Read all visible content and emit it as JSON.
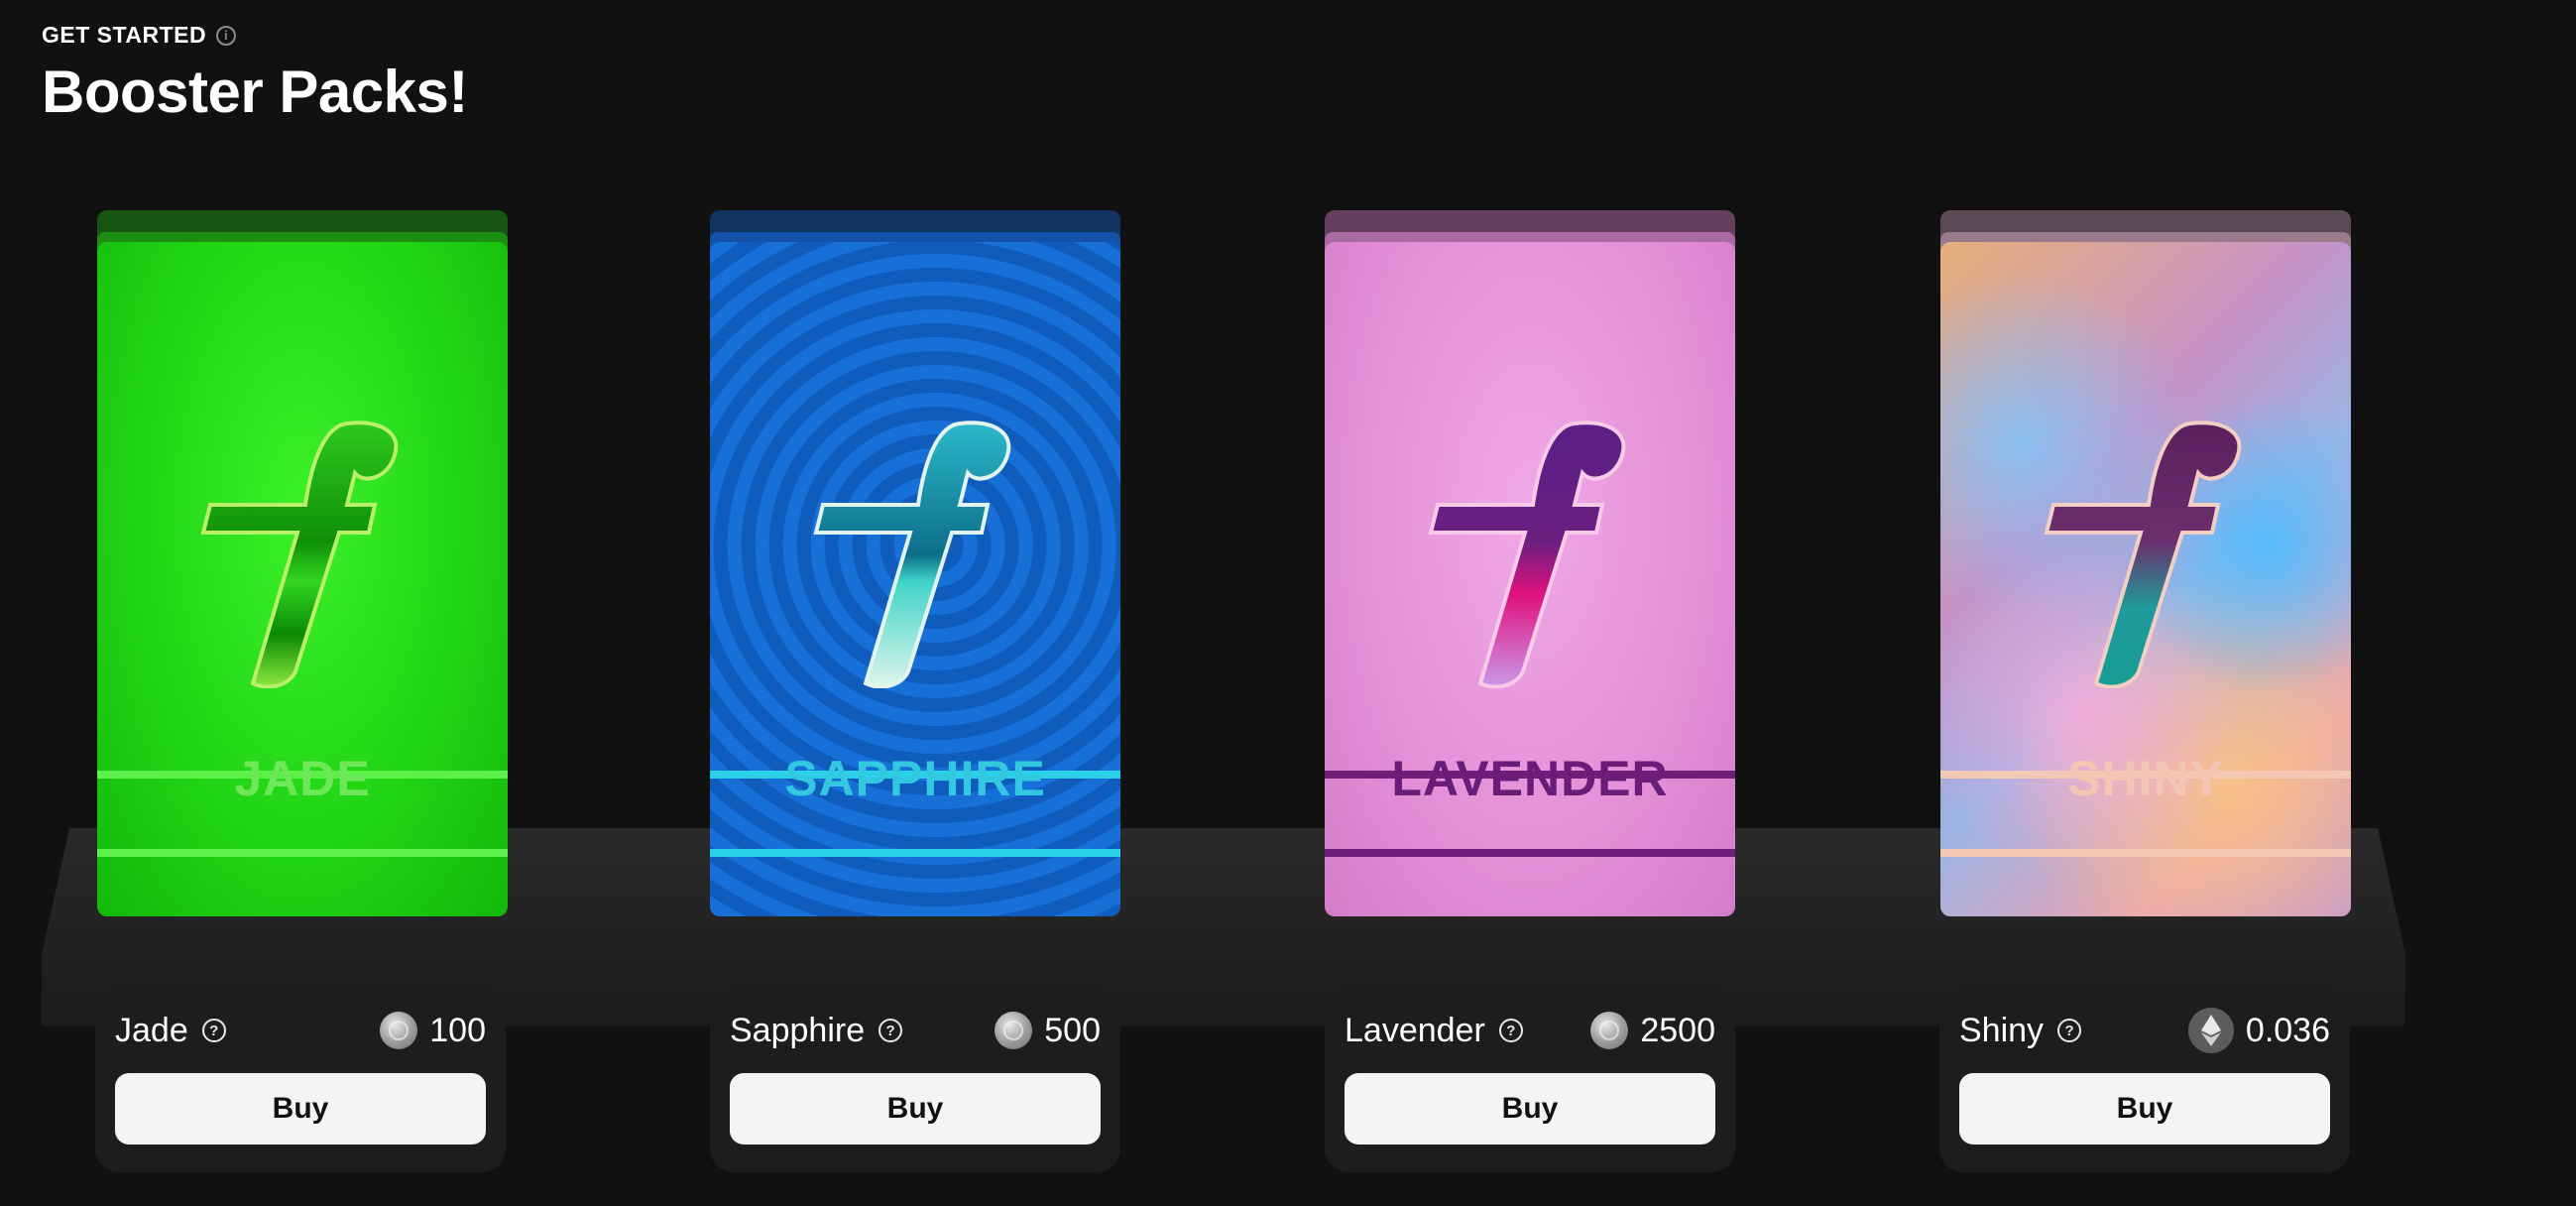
{
  "header": {
    "eyebrow": "GET STARTED",
    "title": "Booster Packs!"
  },
  "packs": [
    {
      "pack_label": "JADE",
      "name": "Jade",
      "price": "100",
      "currency_icon": "coin-icon",
      "buy_label": "Buy"
    },
    {
      "pack_label": "SAPPHIRE",
      "name": "Sapphire",
      "price": "500",
      "currency_icon": "coin-icon",
      "buy_label": "Buy"
    },
    {
      "pack_label": "LAVENDER",
      "name": "Lavender",
      "price": "2500",
      "currency_icon": "coin-icon",
      "buy_label": "Buy"
    },
    {
      "pack_label": "SHINY",
      "name": "Shiny",
      "price": "0.036",
      "currency_icon": "ethereum-icon",
      "buy_label": "Buy"
    }
  ],
  "colors": {
    "background": "#111112",
    "jade": "#22d616",
    "sapphire": "#1670d8",
    "lavender": "#e592d8",
    "shiny": "#c693c7"
  }
}
